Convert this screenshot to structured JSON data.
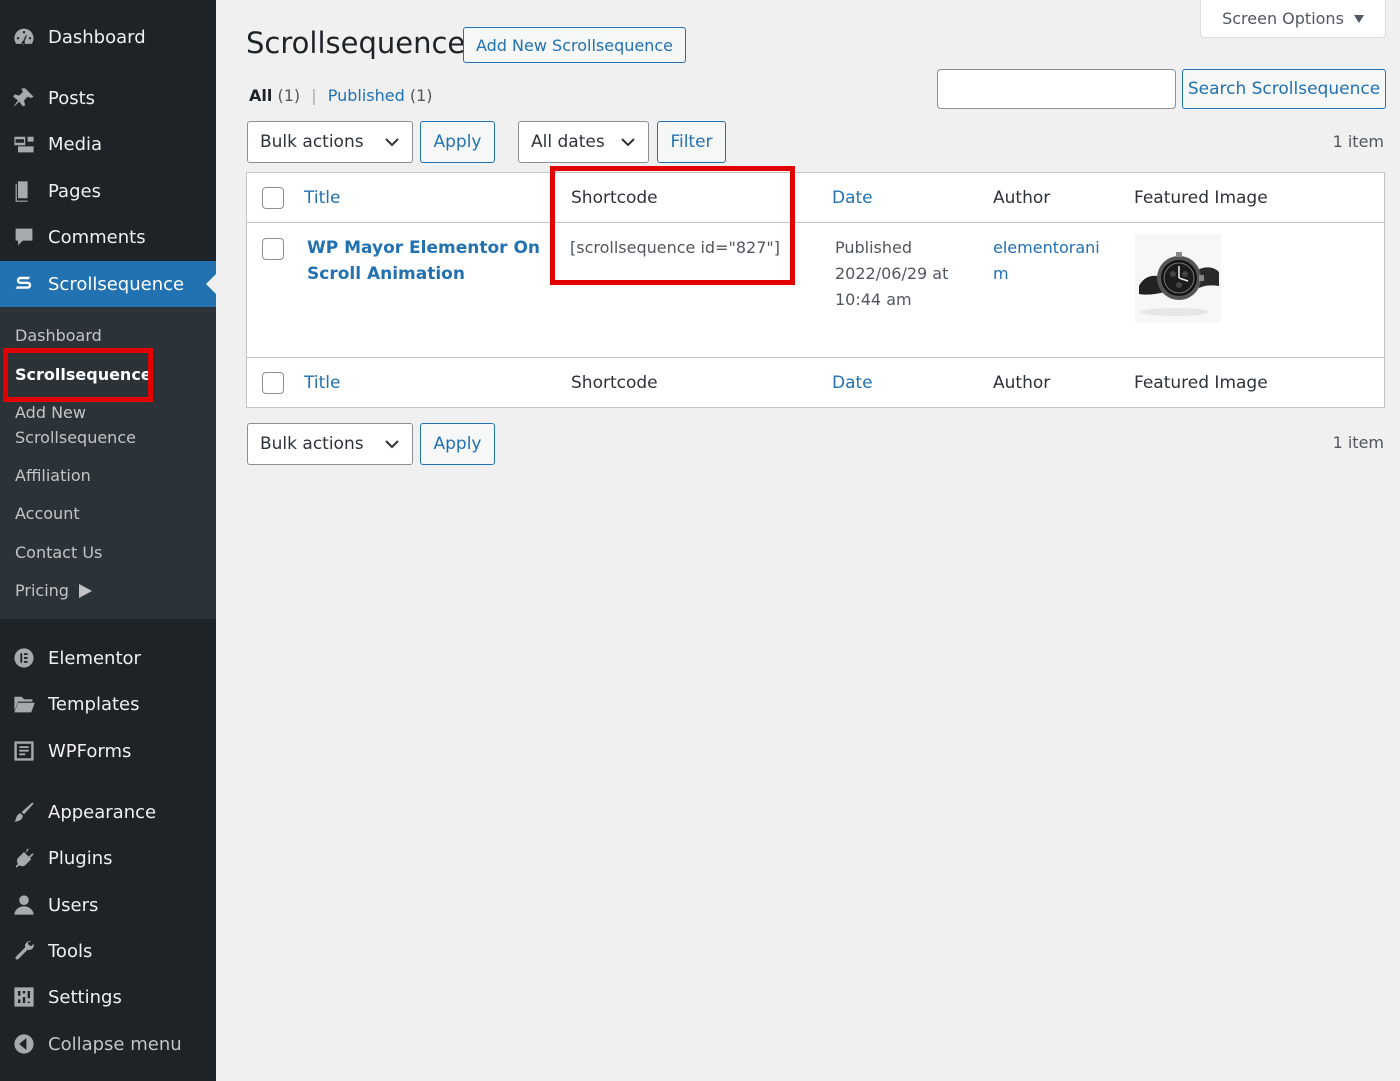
{
  "sidebar": {
    "menu": [
      {
        "label": "Dashboard",
        "icon": "dashboard-icon"
      },
      {
        "label": "Posts",
        "icon": "pushpin-icon"
      },
      {
        "label": "Media",
        "icon": "media-icon"
      },
      {
        "label": "Pages",
        "icon": "pages-icon"
      },
      {
        "label": "Comments",
        "icon": "comment-icon"
      },
      {
        "label": "Scrollsequence",
        "icon": "scrollsequence-icon"
      },
      {
        "label": "Elementor",
        "icon": "elementor-icon"
      },
      {
        "label": "Templates",
        "icon": "folder-icon"
      },
      {
        "label": "WPForms",
        "icon": "wpforms-icon"
      },
      {
        "label": "Appearance",
        "icon": "brush-icon"
      },
      {
        "label": "Plugins",
        "icon": "plugin-icon"
      },
      {
        "label": "Users",
        "icon": "users-icon"
      },
      {
        "label": "Tools",
        "icon": "wrench-icon"
      },
      {
        "label": "Settings",
        "icon": "settings-icon"
      },
      {
        "label": "Collapse menu",
        "icon": "collapse-icon"
      }
    ],
    "submenu": [
      {
        "label": "Dashboard"
      },
      {
        "label": "Scrollsequence"
      },
      {
        "label": "Add New"
      },
      {
        "label": "Scrollsequence"
      },
      {
        "label": "Affiliation"
      },
      {
        "label": "Account"
      },
      {
        "label": "Contact Us"
      },
      {
        "label": "Pricing"
      }
    ]
  },
  "header": {
    "title": "Scrollsequence",
    "add_new": "Add New Scrollsequence",
    "screen_options": "Screen Options"
  },
  "filters": {
    "all": "All",
    "all_count": "(1)",
    "sep": "|",
    "published": "Published",
    "published_count": "(1)",
    "search_button": "Search Scrollsequence",
    "bulk_actions": "Bulk actions",
    "apply": "Apply",
    "all_dates": "All dates",
    "filter": "Filter",
    "items_count": "1 item"
  },
  "table": {
    "columns": [
      "Title",
      "Shortcode",
      "Date",
      "Author",
      "Featured Image"
    ],
    "row": {
      "title_line1": "WP Mayor Elementor On",
      "title_line2": "Scroll Animation",
      "shortcode": "[scrollsequence id=\"827\"]",
      "date_status": "Published",
      "date_line1": "2022/06/29 at",
      "date_line2": "10:44 am",
      "author_line1": "elementorani",
      "author_line2": "m"
    }
  },
  "colors": {
    "accent": "#2271b1",
    "sidebar_bg": "#1d2327",
    "highlight": "#e00000"
  }
}
